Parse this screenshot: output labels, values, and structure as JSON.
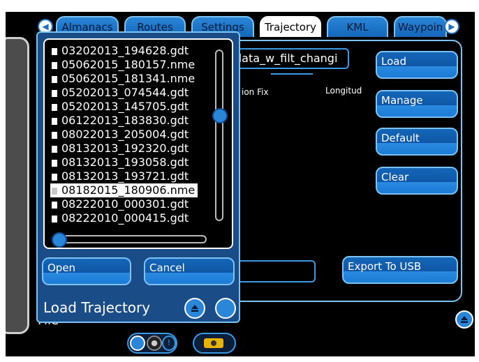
{
  "tabs": [
    {
      "label": "Almanacs",
      "active": false
    },
    {
      "label": "Routes",
      "active": false
    },
    {
      "label": "Settings",
      "active": false
    },
    {
      "label": "Trajectory",
      "active": true
    },
    {
      "label": "KML",
      "active": false
    },
    {
      "label": "Waypoin",
      "active": false
    }
  ],
  "main": {
    "filename_value": "data_w_filt_changi",
    "col_fix": "ion Fix",
    "col_longitude": "Longitud",
    "buttons": {
      "load": "Load",
      "manage": "Manage",
      "default": "Default",
      "clear": "Clear",
      "export_usb": "Export To USB"
    },
    "bottom_label_partial": "File"
  },
  "dialog": {
    "title": "Load Trajectory",
    "files": [
      "03202013_194628.gdt",
      "05062015_180157.nme",
      "05062015_181341.nme",
      "05202013_074544.gdt",
      "05202013_145705.gdt",
      "06122013_183830.gdt",
      "08022013_205004.gdt",
      "08132013_192320.gdt",
      "08132013_193058.gdt",
      "08132013_193721.gdt",
      "08182015_180906.nme",
      "08222010_000301.gdt",
      "08222010_000415.gdt"
    ],
    "selected_file": "08182015_180906.nme",
    "open_label": "Open",
    "cancel_label": "Cancel"
  },
  "colors": {
    "accent": "#1466b8",
    "border": "#7cc2f2",
    "background": "#000000",
    "dialog_bg": "#1a4d87"
  },
  "icons": {
    "tab_prev": "chevron-left-icon",
    "tab_next": "chevron-right-icon",
    "eject": "eject-icon",
    "battery": "battery-icon",
    "lock": "lock-icon"
  }
}
